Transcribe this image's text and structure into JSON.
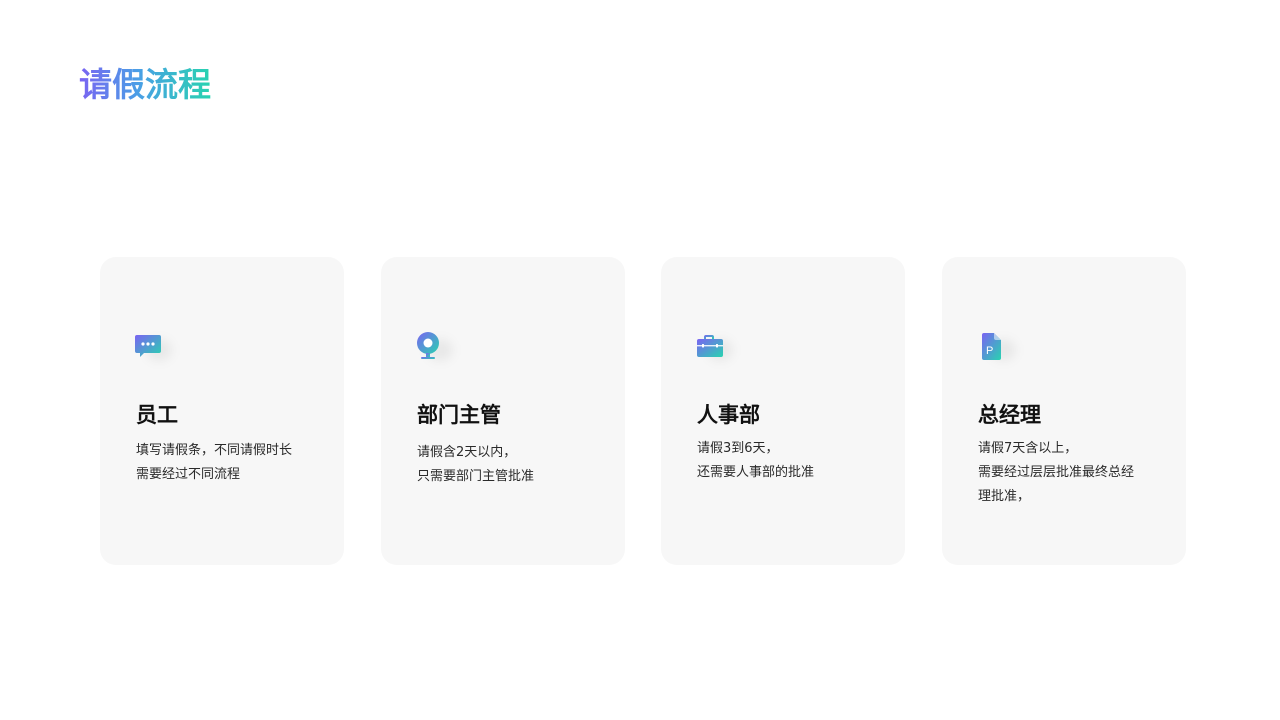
{
  "page": {
    "title": "请假流程"
  },
  "colors": {
    "gradient_start": "#7a63f2",
    "gradient_end": "#28d3b0",
    "card_bg": "#f7f7f7"
  },
  "cards": [
    {
      "icon": "chat-bubble-icon",
      "title": "员工",
      "lines": [
        "填写请假条，不同请假时长",
        "需要经过不同流程"
      ]
    },
    {
      "icon": "location-pin-icon",
      "title": "部门主管",
      "lines": [
        "请假含2天以内，",
        "只需要部门主管批准"
      ]
    },
    {
      "icon": "briefcase-icon",
      "title": "人事部",
      "lines": [
        "请假3到6天，",
        "还需要人事部的批准"
      ]
    },
    {
      "icon": "document-icon",
      "title": "总经理",
      "lines": [
        "请假7天含以上，",
        "需要经过层层批准最终总经",
        "理批准，"
      ]
    }
  ]
}
